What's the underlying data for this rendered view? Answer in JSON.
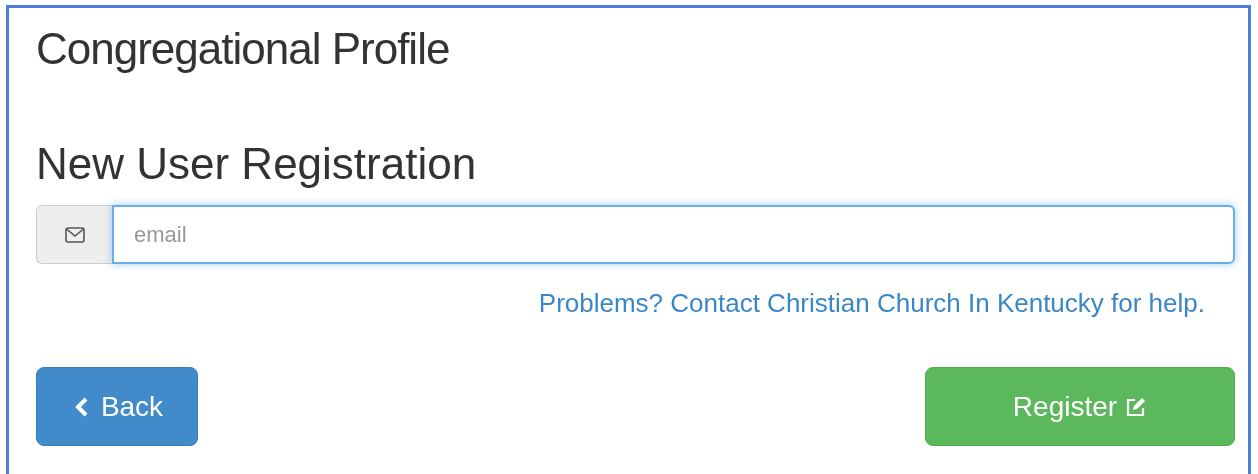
{
  "page_title": "Congregational Profile",
  "heading": "New User Registration",
  "email_field": {
    "placeholder": "email"
  },
  "help_link": "Problems? Contact Christian Church In Kentucky for help.",
  "buttons": [
    {
      "kind": "back",
      "label": "Back"
    },
    {
      "kind": "register",
      "label": "Register"
    }
  ]
}
